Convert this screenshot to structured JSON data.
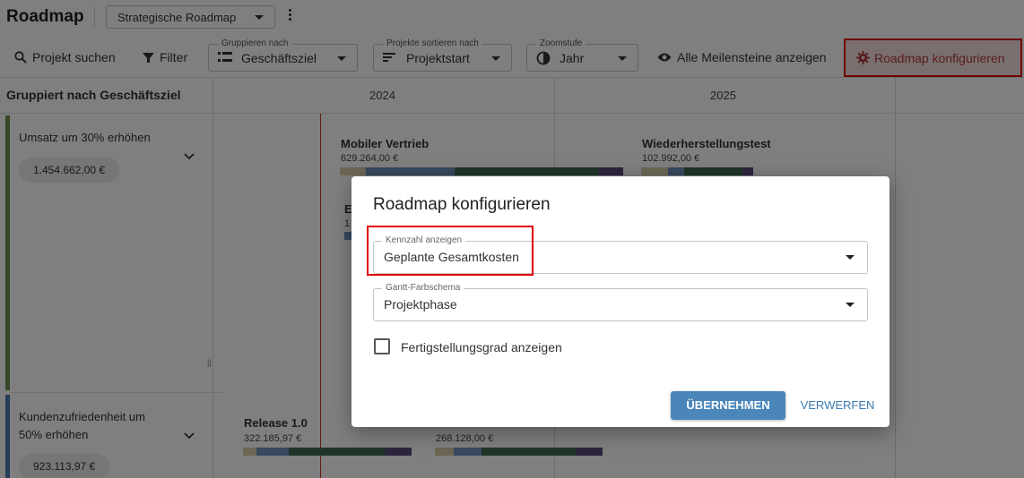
{
  "header": {
    "title": "Roadmap",
    "roadmap_select": "Strategische Roadmap"
  },
  "toolbar": {
    "search": "Projekt suchen",
    "filter": "Filter",
    "group_by": {
      "legend": "Gruppieren nach",
      "value": "Geschäftsziel"
    },
    "sort_by": {
      "legend": "Projekte sortieren nach",
      "value": "Projektstart"
    },
    "zoom": {
      "legend": "Zoomstufe",
      "value": "Jahr"
    },
    "show_milestones": "Alle Meilensteine anzeigen",
    "configure": "Roadmap konfigurieren"
  },
  "grid": {
    "group_header": "Gruppiert nach Geschäftsziel",
    "years": [
      "2024",
      "2025"
    ],
    "groups": [
      {
        "label_line1": "Umsatz um 30% erhöhen",
        "label_line2": "",
        "amount": "1.454.662,00 €",
        "color": "#6b8e4e",
        "projects": [
          {
            "title": "Mobiler Vertrieb",
            "cost": "629.264,00 €"
          },
          {
            "title": "Wiederherstellungstest",
            "cost": "102.992,00 €"
          },
          {
            "title": "E",
            "cost": "1"
          }
        ]
      },
      {
        "label_line1": "Kundenzufriedenheit um",
        "label_line2": "50% erhöhen",
        "amount": "923.113,97 €",
        "color": "#4a7fb0",
        "projects": [
          {
            "title": "Release 1.0",
            "cost": "322.185,97 €"
          },
          {
            "title": "",
            "cost": "268.128,00 €"
          }
        ]
      }
    ]
  },
  "phase_colors": [
    "#d8cfa8",
    "#6f93bf",
    "#3f6b52",
    "#5a4a7a"
  ],
  "dialog": {
    "title": "Roadmap konfigurieren",
    "metric": {
      "legend": "Kennzahl anzeigen",
      "value": "Geplante Gesamtkosten"
    },
    "color_scheme": {
      "legend": "Gantt-Farbschema",
      "value": "Projektphase"
    },
    "show_completion": {
      "label": "Fertigstellungsgrad anzeigen",
      "checked": false
    },
    "apply": "ÜBERNEHMEN",
    "discard": "VERWERFEN"
  }
}
